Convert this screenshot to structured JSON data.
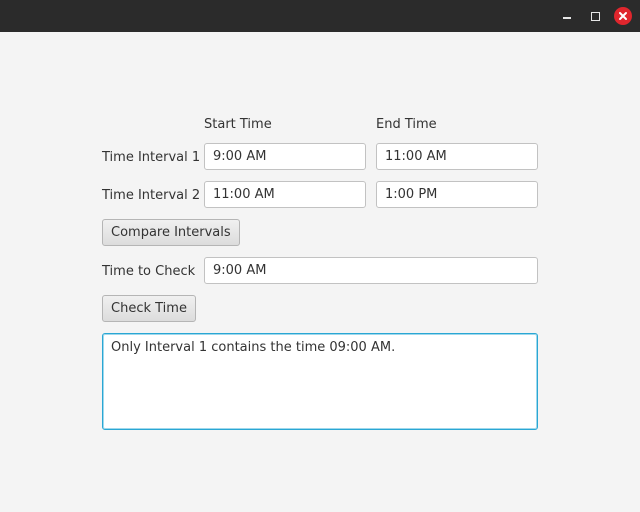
{
  "titlebar": {
    "minimize_icon": "minimize-icon",
    "maximize_icon": "maximize-icon",
    "close_icon": "close-icon",
    "close_color": "#e0262d"
  },
  "headers": {
    "start_time": "Start Time",
    "end_time": "End Time"
  },
  "interval1": {
    "label": "Time Interval 1",
    "start": "9:00 AM",
    "end": "11:00 AM"
  },
  "interval2": {
    "label": "Time Interval 2",
    "start": "11:00 AM",
    "end": "1:00 PM"
  },
  "compare_button": "Compare Intervals",
  "check": {
    "label": "Time to Check",
    "value": "9:00 AM"
  },
  "check_button": "Check Time",
  "result": {
    "text": "Only Interval 1 contains the time 09:00 AM.",
    "focus_color": "#2aa7d4"
  }
}
